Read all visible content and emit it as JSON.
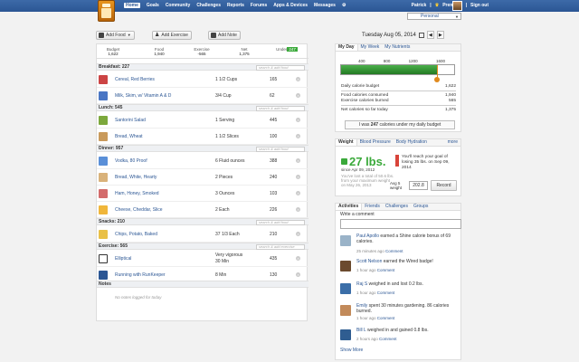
{
  "nav": {
    "items": [
      "Home",
      "Goals",
      "Community",
      "Challenges",
      "Reports",
      "Forums",
      "Apps & Devices",
      "Messages"
    ],
    "active": "Home",
    "user": "Patrick",
    "premium": "Premium",
    "signout": "Sign out",
    "personal_select": "Personal"
  },
  "toolbar": {
    "add_food": "Add Food",
    "add_exercise": "Add Exercise",
    "add_note": "Add Note"
  },
  "date": {
    "label": "Tuesday Aug 05, 2014"
  },
  "summary": {
    "budget_label": "Budget",
    "budget": "1,622",
    "food_label": "Food",
    "food": "1,940",
    "exercise_label": "Exercise",
    "exercise": "-565",
    "net_label": "Net",
    "net": "1,375",
    "under_label": "Under",
    "under": "247"
  },
  "meals": {
    "search_placeholder": "search & add food",
    "breakfast": {
      "title": "Breakfast: 227",
      "items": [
        {
          "name": "Cereal, Red Berries",
          "qty": "1 1/2 Cups",
          "cal": "165"
        },
        {
          "name": "Milk, Skim, w/ Vitamin A & D",
          "qty": "3/4 Cup",
          "cal": "62"
        }
      ]
    },
    "lunch": {
      "title": "Lunch: 545",
      "items": [
        {
          "name": "Santorini Salad",
          "qty": "1 Serving",
          "cal": "445"
        },
        {
          "name": "Bread, Wheat",
          "qty": "1 1/2 Slices",
          "cal": "100"
        }
      ]
    },
    "dinner": {
      "title": "Dinner: 957",
      "items": [
        {
          "name": "Vodka, 80 Proof",
          "qty": "6 Fluid ounces",
          "cal": "388"
        },
        {
          "name": "Bread, White, Hearty",
          "qty": "2 Pieces",
          "cal": "240"
        },
        {
          "name": "Ham, Honey, Smoked",
          "qty": "3 Ounces",
          "cal": "103"
        },
        {
          "name": "Cheese, Cheddar, Slice",
          "qty": "2 Each",
          "cal": "226"
        }
      ]
    },
    "snacks": {
      "title": "Snacks: 210",
      "items": [
        {
          "name": "Chips, Potato, Baked",
          "qty": "37 1/3 Each",
          "cal": "210"
        }
      ]
    },
    "exercise": {
      "title": "Exercise: 565",
      "search_placeholder": "search & add exercise",
      "items": [
        {
          "name": "Elliptical",
          "qty_line1": "Very vigorous",
          "qty_line2": "30 Min",
          "cal": "435"
        },
        {
          "name": "Running with RunKeeper",
          "qty": "8 Min",
          "cal": "130"
        }
      ]
    },
    "notes": {
      "title": "Notes",
      "empty": "No notes logged for today"
    }
  },
  "myday": {
    "tabs": [
      "My Day",
      "My Week",
      "My Nutrients"
    ],
    "scale": [
      "400",
      "800",
      "1200",
      "1600"
    ],
    "fill_fraction": 0.85,
    "budget_marker_fraction": 0.85,
    "daily_budget_label": "Daily calorie budget",
    "daily_budget": "1,622",
    "food_consumed_label": "Food calories consumed",
    "food_consumed": "1,940",
    "exercise_burned_label": "Exercise calories burned",
    "exercise_burned": "565",
    "net_label": "Net calories so far today",
    "net": "1,375",
    "under_text_prefix": "I was",
    "under_value": "247",
    "under_text_suffix": "calories under my daily budget"
  },
  "weight": {
    "tabs": [
      "Weight",
      "Blood Pressure",
      "Body Hydration"
    ],
    "more": "more",
    "lost": "27 lbs.",
    "since": "since Apr 09, 2012",
    "detail": "You've lost a total of 50.6 lbs. from your maximum weight on May 26, 2013",
    "reach_text": "You'll reach your goal of losing 35 lbs. on Sep 09, 2014",
    "avg_label": "Avg 5 weight",
    "avg_value": "202.8",
    "record": "Record"
  },
  "activities": {
    "tabs": [
      "Activities",
      "Friends",
      "Challenges",
      "Groups"
    ],
    "write_label": "Write a comment",
    "feed": [
      {
        "user": "Paul Apollo",
        "text": "earned a Shine calorie bonus of 69 calories.",
        "time": "25 minutes ago",
        "comment": "Comment",
        "color": "#9ab3c8"
      },
      {
        "user": "Scott Nelson",
        "text": "earned the Wired badge!",
        "time": "1 hour ago",
        "comment": "Comment",
        "color": "#6b4a2e"
      },
      {
        "user": "Raj S",
        "text": "weighed in and lost 0.2 lbs.",
        "time": "1 hour ago",
        "comment": "Comment",
        "color": "#3b6ea8"
      },
      {
        "user": "Emily",
        "text": "spent 30 minutes gardening. 86 calories burned.",
        "time": "1 hour ago",
        "comment": "Comment",
        "color": "#c28a5a"
      },
      {
        "user": "Bill L",
        "text": "weighed in and gained 0.8 lbs.",
        "time": "2 hours ago",
        "comment": "Comment",
        "color": "#2f5d91"
      }
    ],
    "show_more": "Show More"
  }
}
